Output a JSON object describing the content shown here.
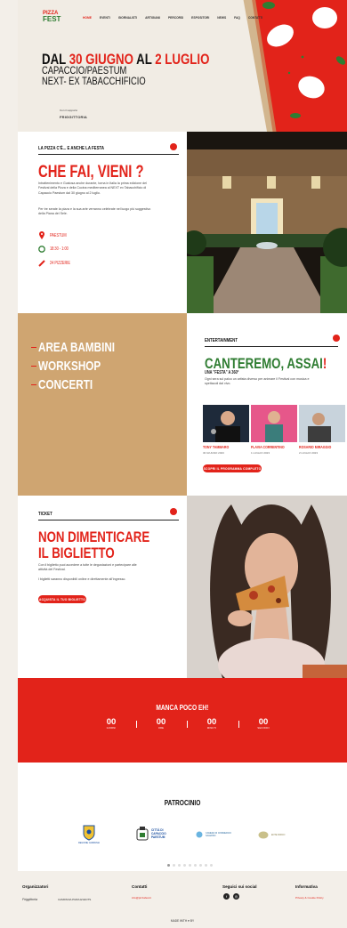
{
  "brand": {
    "logo_top": "PIZZA",
    "logo_bottom": "FEST",
    "colors": {
      "red": "#e2231a",
      "gold": "#cfa571",
      "cream": "#f1ece4"
    }
  },
  "nav": {
    "items": [
      "HOME",
      "EVENTI",
      "GIORNALISTI",
      "ARTIGIANI",
      "PERCORSI",
      "ESPOSITORI",
      "NEWS",
      "FAQ",
      "CONTATTI"
    ]
  },
  "hero": {
    "title_prefix": "DAL ",
    "title_date1": "30 GIUGNO",
    "title_mid": " AL ",
    "title_date2": "2 LUGLIO",
    "location1": "CAPACCIO/PAESTUM",
    "location2": "NEXT- EX TABACCHIFICIO",
    "partner_label": "Con il supporto",
    "partner_name": "FRIGGITTORIA"
  },
  "festa": {
    "kicker": "LA PIZZA C'È... E ANCHE LA FESTA",
    "title": "CHE FAI, VIENI ?",
    "body1": "Intrattenimento e Gustosa anche durante, torna in Italia la prima edizione del Festival della Pizza e della Cucina mediterranea al NEXT ex Tabacchificio di Capaccio Paestum dal 30 giugno al 2 luglio.",
    "body2": "Per tre serate la pizza e la sua arte verranno celebrate nel luogo più suggestivo della Piana del Sele.",
    "place": "PAESTUM",
    "hours": "18:30 - 1:00",
    "count": "24 PIZZERIE"
  },
  "activities": {
    "items": [
      "AREA BAMBINI",
      "WORKSHOP",
      "CONCERTI"
    ]
  },
  "entertainment": {
    "kicker": "ENTERTAINMENT",
    "title_main": "CANTEREMO, ASSAI",
    "title_excl": "!",
    "subtitle": "UNA \"FESTA\" A 360°",
    "body": "Ogni sera sul palco un artista diverso per animare il Festival con musica e spettacoli dal vivo.",
    "artists": [
      {
        "name": "TONY TAMMARO",
        "date": "30 GIUGNO 2023"
      },
      {
        "name": "FLAVIA CORRENTINO",
        "date": "1 LUGLIO 2023"
      },
      {
        "name": "ROSARIO MIRAGGIO",
        "date": "2 LUGLIO 2023"
      }
    ],
    "button": "SCOPRI IL PROGRAMMA COMPLETO"
  },
  "ticket": {
    "kicker": "TICKET",
    "title1": "NON DIMENTICARE",
    "title2": "IL BIGLIETTO",
    "body1": "Con il biglietto puoi accedere a tutte le degustazioni e partecipare alle attività del Festival.",
    "body2": "I biglietti saranno disponibili online e direttamente all'ingresso.",
    "button": "ACQUISTA IL TUO BIGLIETTO"
  },
  "countdown": {
    "title": "MANCA POCO EH!",
    "units": [
      {
        "value": "00",
        "label": "GIORNI"
      },
      {
        "value": "00",
        "label": "ORE"
      },
      {
        "value": "00",
        "label": "MINUTI"
      },
      {
        "value": "00",
        "label": "SECONDI"
      }
    ]
  },
  "patrocinio": {
    "title": "PATROCINIO",
    "logos": [
      "REGIONE CAMPANIA",
      "CITTÀ DI CAPACCIO PAESTUM",
      "CAMERA DI COMMERCIO SALERNO",
      "ENTE PARCO"
    ]
  },
  "footer": {
    "col1": "Organizzatori",
    "col1_logo1": "Friggittoria",
    "col1_logo2": "CAMPANIA PIZZA EVENTS",
    "col2": "Contatti",
    "col2_sub": "info@pizzafest.it",
    "col3": "Seguici sui social",
    "col4": "Informativa",
    "col4_sub": "Privacy & Cookie Policy",
    "bottom": "MADE WITH ♥ BY"
  }
}
